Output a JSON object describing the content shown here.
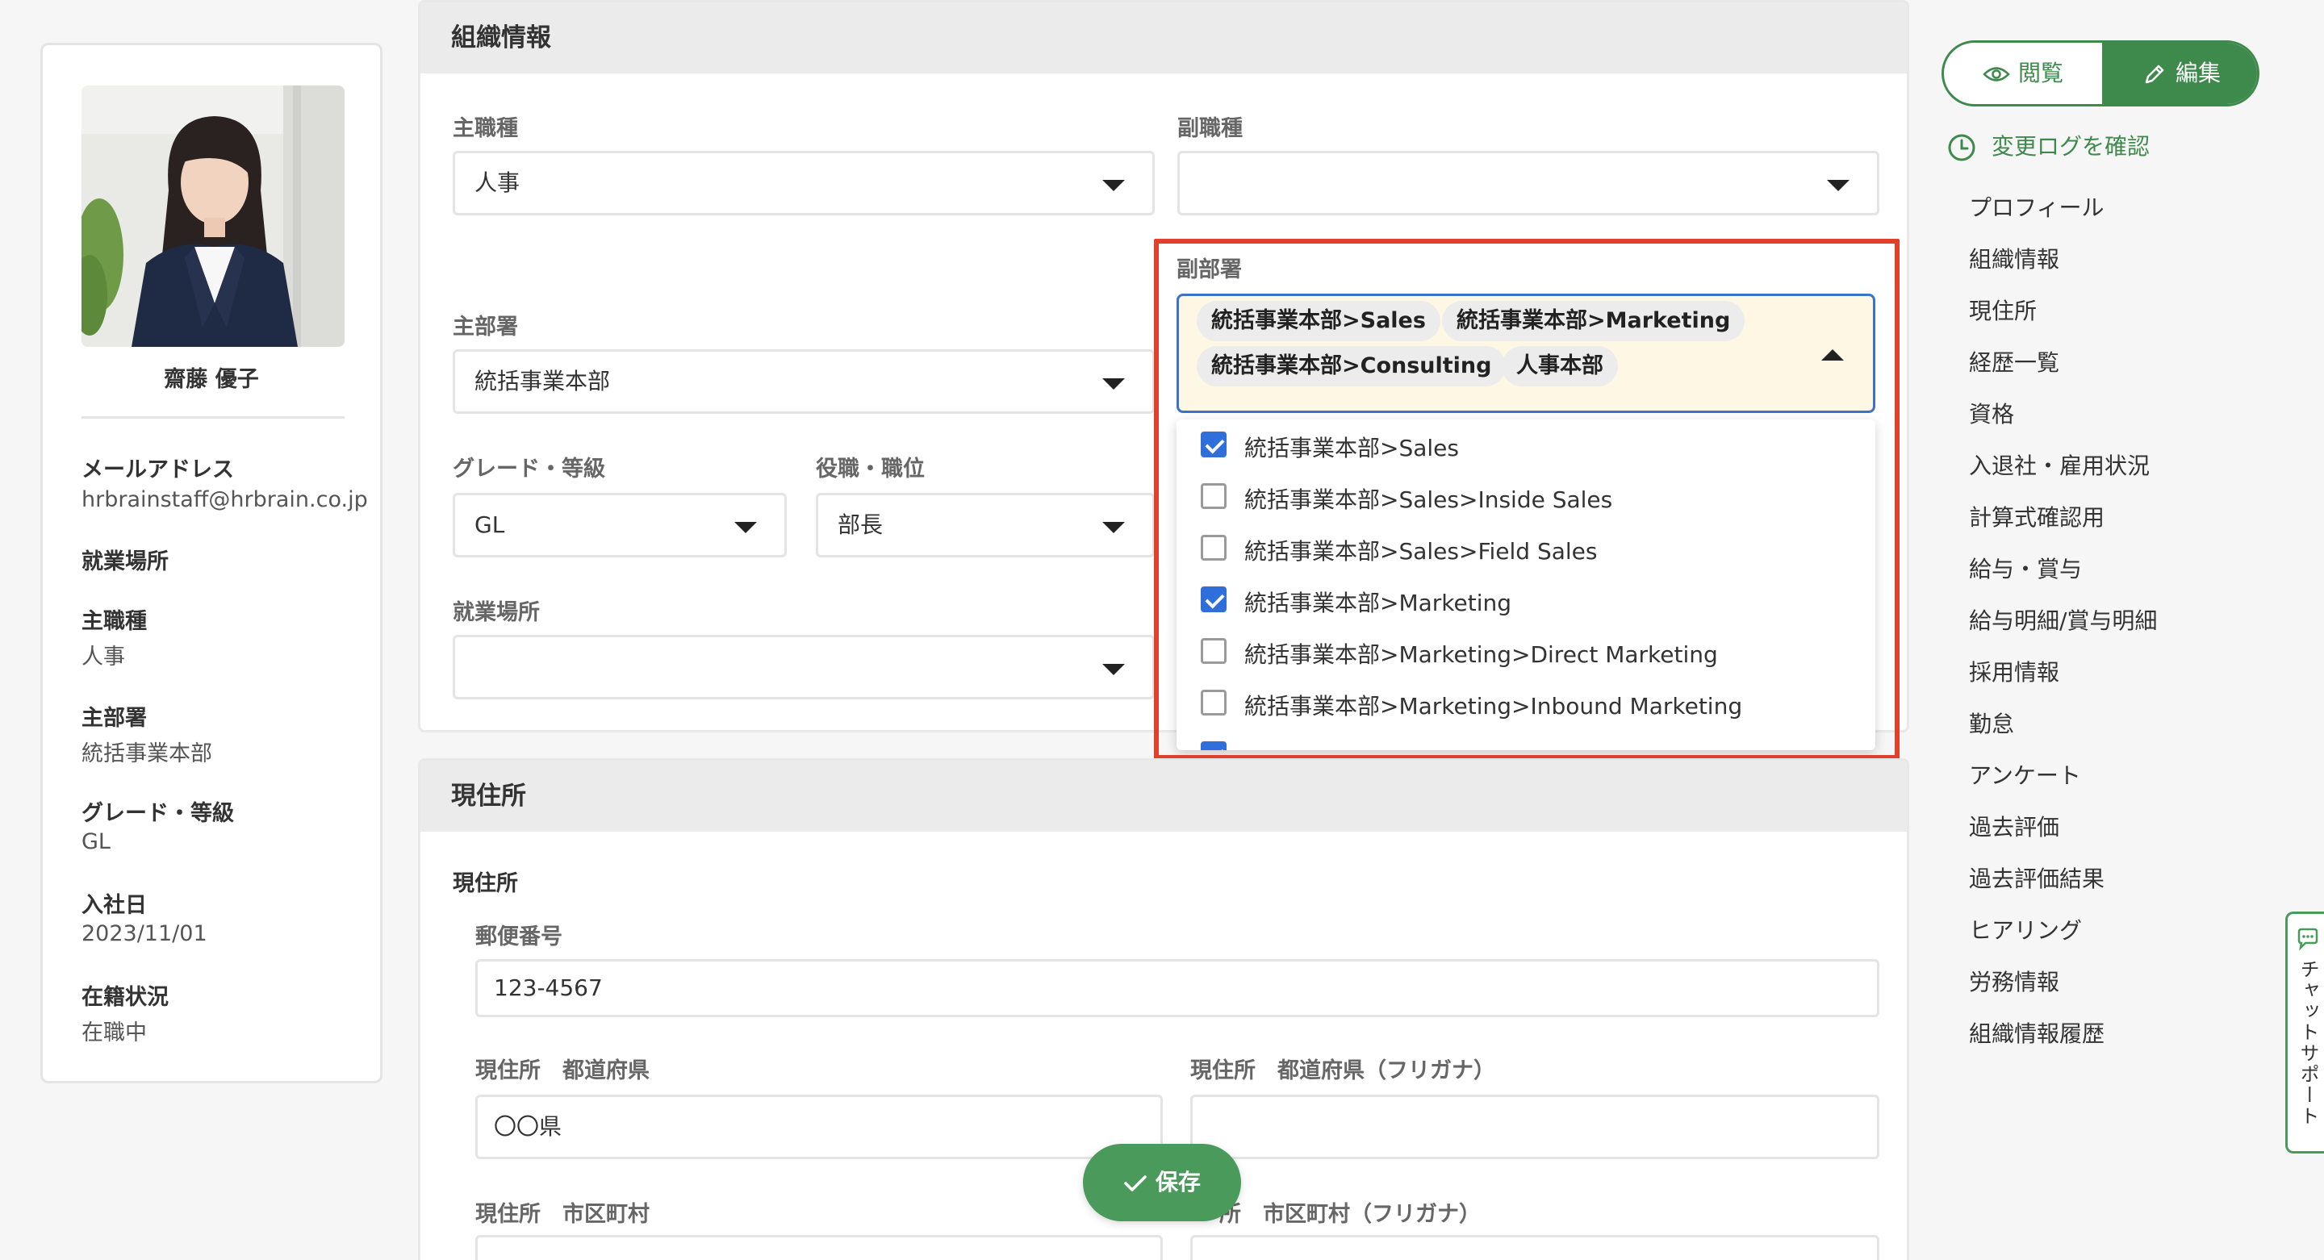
{
  "profile": {
    "name": "齋藤 優子",
    "fields": [
      {
        "label": "メールアドレス",
        "value": "hrbrainstaff@hrbrain.co.jp"
      },
      {
        "label": "就業場所",
        "value": ""
      },
      {
        "label": "主職種",
        "value": "人事"
      },
      {
        "label": "主部署",
        "value": "統括事業本部"
      },
      {
        "label": "グレード・等級",
        "value": "GL"
      },
      {
        "label": "入社日",
        "value": "2023/11/01"
      },
      {
        "label": "在籍状況",
        "value": "在職中"
      }
    ]
  },
  "org": {
    "title": "組織情報",
    "main_job": {
      "label": "主職種",
      "value": "人事"
    },
    "sub_job": {
      "label": "副職種",
      "value": ""
    },
    "main_dept": {
      "label": "主部署",
      "value": "統括事業本部"
    },
    "grade": {
      "label": "グレード・等級",
      "value": "GL"
    },
    "position": {
      "label": "役職・職位",
      "value": "部長"
    },
    "workplace": {
      "label": "就業場所",
      "value": ""
    },
    "sub_dept": {
      "label": "副部署",
      "chips": [
        "統括事業本部>Sales",
        "統括事業本部>Marketing",
        "統括事業本部>Consulting",
        "人事本部"
      ],
      "options": [
        {
          "label": "統括事業本部>Sales",
          "checked": true
        },
        {
          "label": "統括事業本部>Sales>Inside Sales",
          "checked": false
        },
        {
          "label": "統括事業本部>Sales>Field Sales",
          "checked": false
        },
        {
          "label": "統括事業本部>Marketing",
          "checked": true
        },
        {
          "label": "統括事業本部>Marketing>Direct Marketing",
          "checked": false
        },
        {
          "label": "統括事業本部>Marketing>Inbound Marketing",
          "checked": false
        }
      ]
    },
    "highlight_color": "#e0402c"
  },
  "address": {
    "title": "現住所",
    "subtitle": "現住所",
    "postal": {
      "label": "郵便番号",
      "value": "123-4567"
    },
    "pref": {
      "label": "現住所　都道府県",
      "value": "〇〇県"
    },
    "pref_kana": {
      "label": "現住所　都道府県（フリガナ）",
      "value": ""
    },
    "city": {
      "label": "現住所　市区町村"
    },
    "city_kana": {
      "label": "所　市区町村（フリガナ）"
    }
  },
  "save_label": "保存",
  "toolbar": {
    "view_label": "閲覧",
    "edit_label": "編集",
    "accent": "#3d8a4c"
  },
  "changelog_label": "変更ログを確認",
  "nav": [
    "プロフィール",
    "組織情報",
    "現住所",
    "経歴一覧",
    "資格",
    "入退社・雇用状況",
    "計算式確認用",
    "給与・賞与",
    "給与明細/賞与明細",
    "採用情報",
    "勤怠",
    "アンケート",
    "過去評価",
    "過去評価結果",
    "ヒアリング",
    "労務情報",
    "組織情報履歴"
  ],
  "chat_label": "チャットサポート"
}
